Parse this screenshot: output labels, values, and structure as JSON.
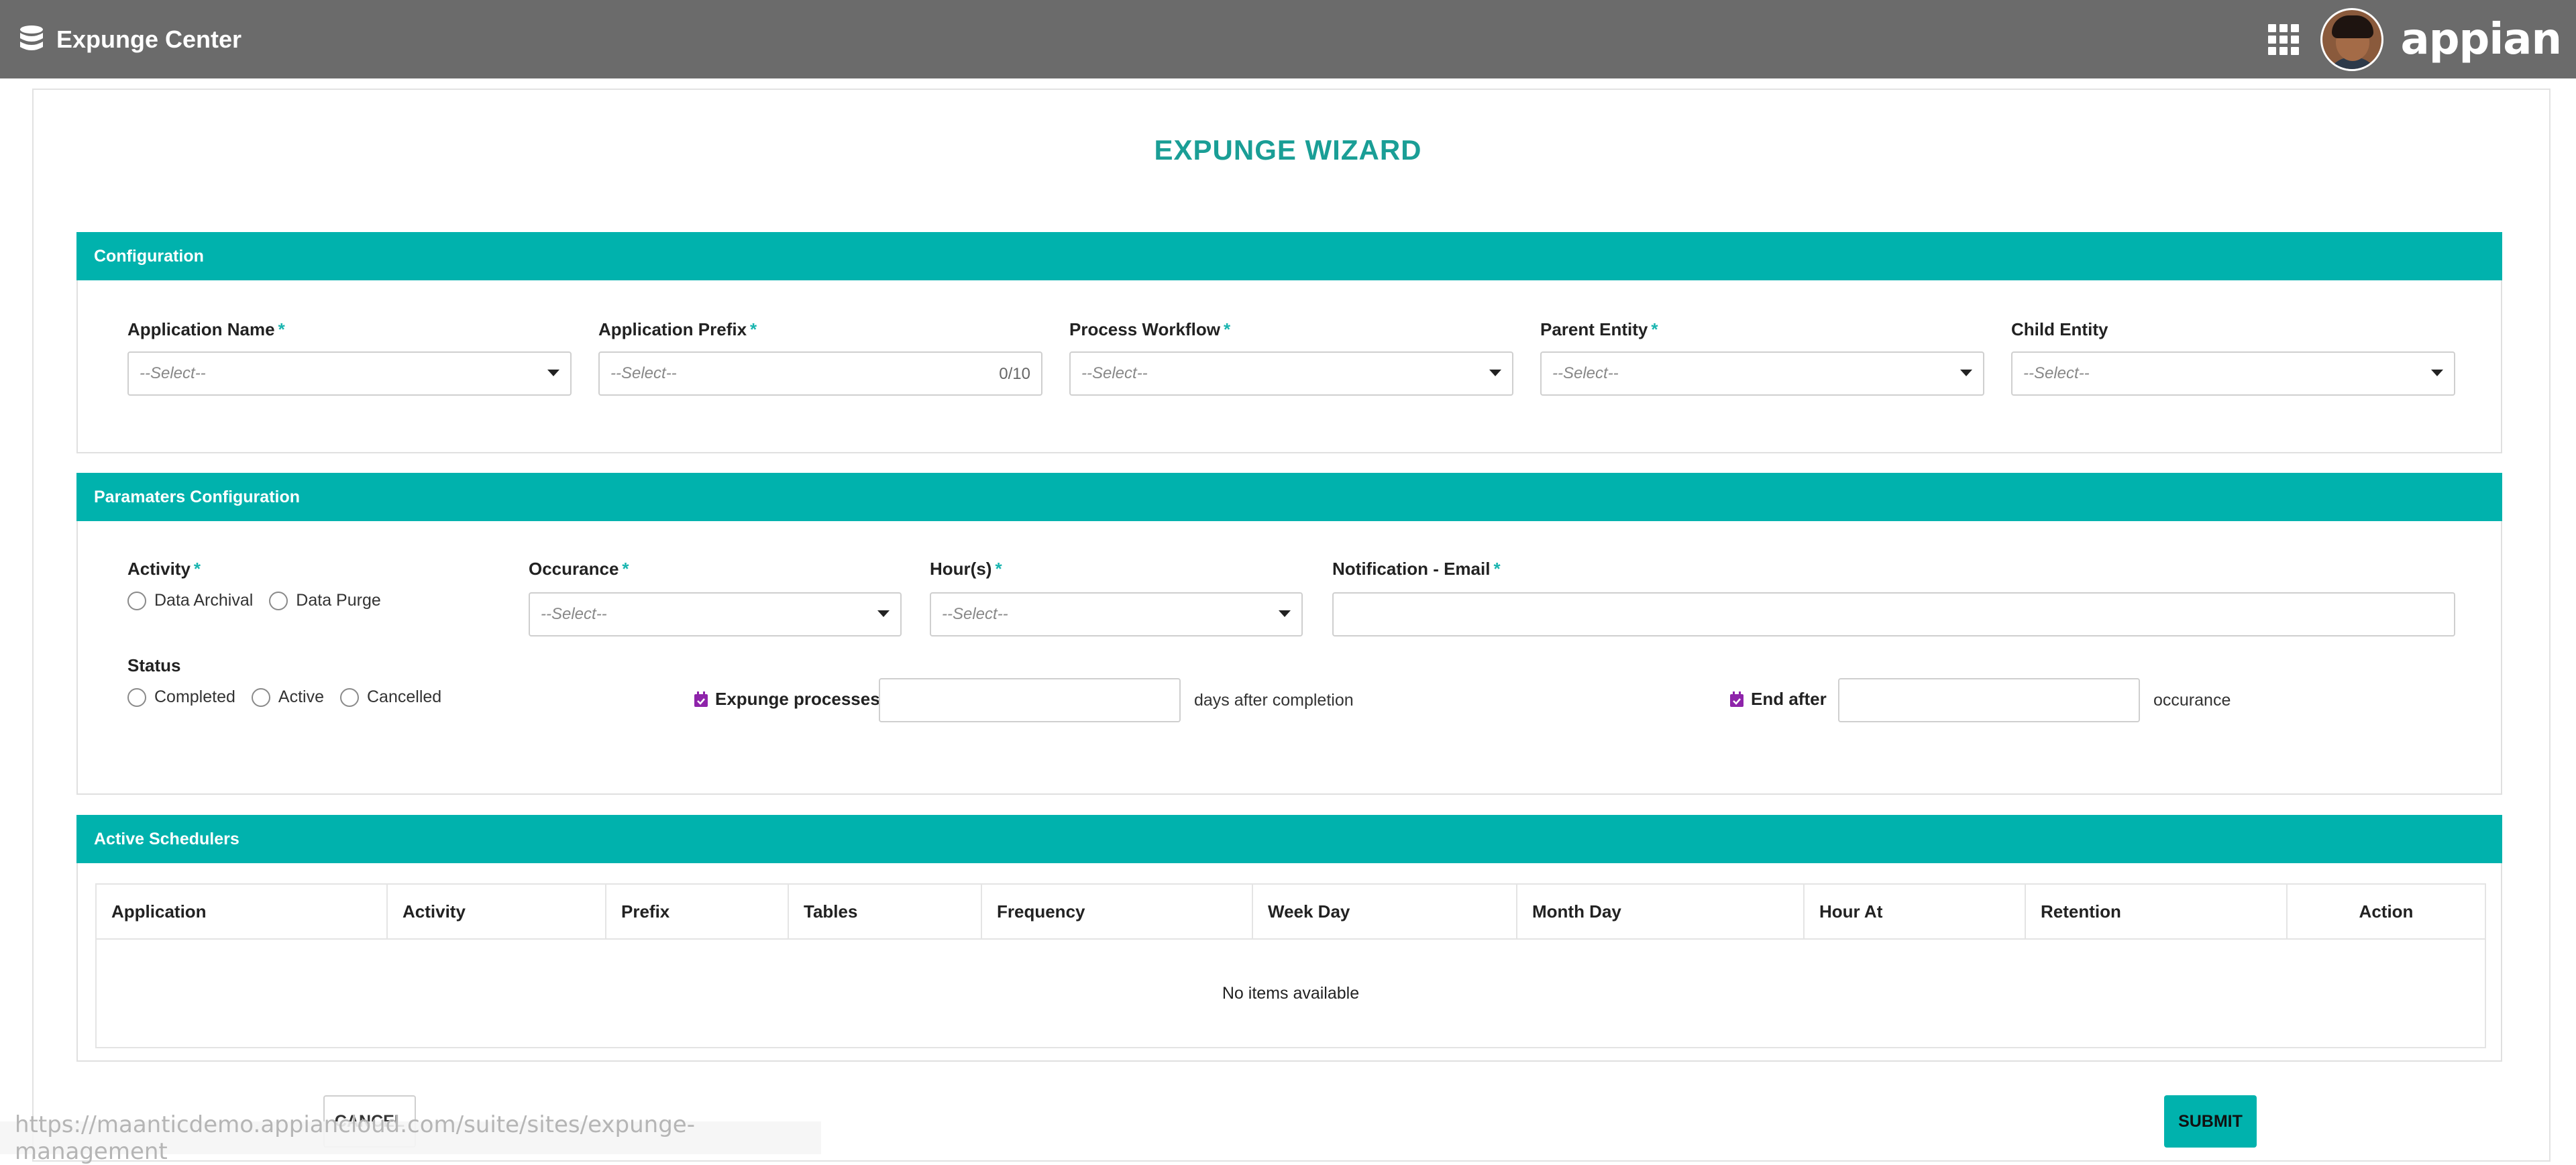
{
  "header": {
    "title": "Expunge Center",
    "logo_text": "appian"
  },
  "wizard": {
    "title": "EXPUNGE WIZARD"
  },
  "configuration": {
    "section_title": "Configuration",
    "fields": {
      "application_name": {
        "label": "Application Name",
        "value": "--Select--"
      },
      "application_prefix": {
        "label": "Application Prefix",
        "value": "--Select--",
        "counter": "0/10"
      },
      "process_workflow": {
        "label": "Process Workflow",
        "value": "--Select--"
      },
      "parent_entity": {
        "label": "Parent Entity",
        "value": "--Select--"
      },
      "child_entity": {
        "label": "Child Entity",
        "value": "--Select--"
      }
    },
    "required_mark": "*"
  },
  "parameters": {
    "section_title": "Paramaters Configuration",
    "activity": {
      "label": "Activity",
      "options": [
        "Data Archival",
        "Data Purge"
      ]
    },
    "occurance": {
      "label": "Occurance",
      "value": "--Select--"
    },
    "hours": {
      "label": "Hour(s)",
      "value": "--Select--"
    },
    "notification": {
      "label": "Notification - Email",
      "value": ""
    },
    "status": {
      "label": "Status",
      "options": [
        "Completed",
        "Active",
        "Cancelled"
      ]
    },
    "expunge": {
      "label": "Expunge processes",
      "value": "",
      "suffix": "days after completion"
    },
    "end_after": {
      "label": "End after",
      "value": "",
      "suffix": "occurance"
    }
  },
  "schedulers": {
    "section_title": "Active Schedulers",
    "columns": [
      "Application",
      "Activity",
      "Prefix",
      "Tables",
      "Frequency",
      "Week Day",
      "Month Day",
      "Hour At",
      "Retention",
      "Action"
    ],
    "empty_text": "No items available"
  },
  "buttons": {
    "cancel": "CANCEL",
    "submit": "SUBMIT"
  },
  "status_bar": {
    "url": "https://maanticdemo.appiancloud.com/suite/sites/expunge-management"
  },
  "colors": {
    "accent": "#00b2ad",
    "title": "#1a9e96",
    "topbar": "#6b6b6b",
    "icon_purple": "#8e24aa"
  },
  "icons": {
    "database": "database-icon",
    "apps": "grid-icon",
    "calendar": "calendar-check-icon"
  }
}
